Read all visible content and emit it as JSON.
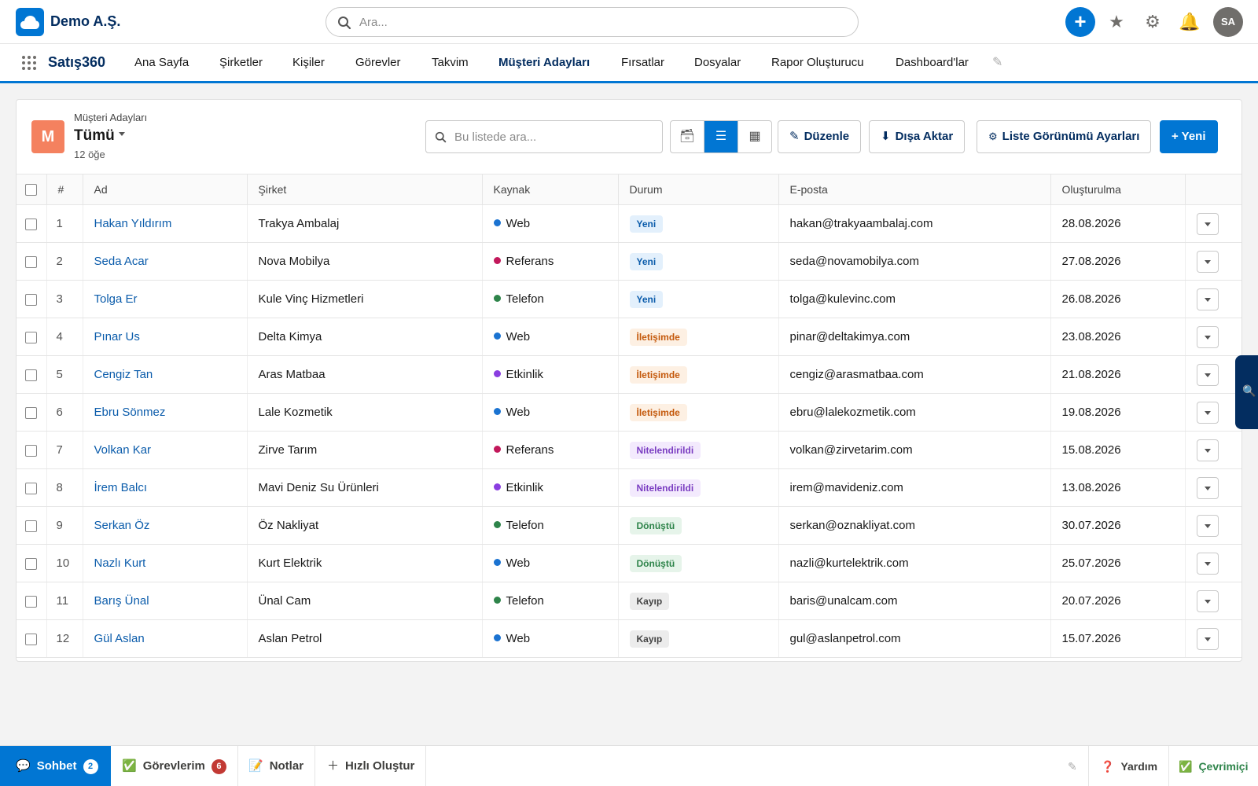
{
  "header": {
    "org_name": "Demo A.Ş.",
    "search_placeholder": "Ara...",
    "avatar_initials": "SA"
  },
  "nav": {
    "app_name": "Satış360",
    "tabs": [
      {
        "label": "Ana Sayfa"
      },
      {
        "label": "Şirketler"
      },
      {
        "label": "Kişiler"
      },
      {
        "label": "Görevler"
      },
      {
        "label": "Takvim"
      },
      {
        "label": "Müşteri Adayları",
        "active": true
      },
      {
        "label": "Fırsatlar"
      },
      {
        "label": "Dosyalar"
      },
      {
        "label": "Rapor Oluşturucu"
      },
      {
        "label": "Dashboard'lar"
      }
    ]
  },
  "list": {
    "object_icon_letter": "M",
    "object_label": "Müşteri Adayları",
    "view_name": "Tümü",
    "item_count": "12 öğe",
    "search_placeholder": "Bu listede ara...",
    "buttons": {
      "edit": "Düzenle",
      "export": "Dışa Aktar",
      "settings": "Liste Görünümü Ayarları",
      "new": "+ Yeni"
    },
    "columns": [
      "#",
      "Ad",
      "Şirket",
      "Kaynak",
      "Durum",
      "E-posta",
      "Oluşturulma"
    ],
    "rows": [
      {
        "num": "1",
        "name": "Hakan Yıldırım",
        "company": "Trakya Ambalaj",
        "source": "Web",
        "status": "Yeni",
        "email": "hakan@trakyaambalaj.com",
        "created": "28.08.2026"
      },
      {
        "num": "2",
        "name": "Seda Acar",
        "company": "Nova Mobilya",
        "source": "Referans",
        "status": "Yeni",
        "email": "seda@novamobilya.com",
        "created": "27.08.2026"
      },
      {
        "num": "3",
        "name": "Tolga Er",
        "company": "Kule Vinç Hizmetleri",
        "source": "Telefon",
        "status": "Yeni",
        "email": "tolga@kulevinc.com",
        "created": "26.08.2026"
      },
      {
        "num": "4",
        "name": "Pınar Us",
        "company": "Delta Kimya",
        "source": "Web",
        "status": "İletişimde",
        "email": "pinar@deltakimya.com",
        "created": "23.08.2026"
      },
      {
        "num": "5",
        "name": "Cengiz Tan",
        "company": "Aras Matbaa",
        "source": "Etkinlik",
        "status": "İletişimde",
        "email": "cengiz@arasmatbaa.com",
        "created": "21.08.2026"
      },
      {
        "num": "6",
        "name": "Ebru Sönmez",
        "company": "Lale Kozmetik",
        "source": "Web",
        "status": "İletişimde",
        "email": "ebru@lalekozmetik.com",
        "created": "19.08.2026"
      },
      {
        "num": "7",
        "name": "Volkan Kar",
        "company": "Zirve Tarım",
        "source": "Referans",
        "status": "Nitelendirildi",
        "email": "volkan@zirvetarim.com",
        "created": "15.08.2026"
      },
      {
        "num": "8",
        "name": "İrem Balcı",
        "company": "Mavi Deniz Su Ürünleri",
        "source": "Etkinlik",
        "status": "Nitelendirildi",
        "email": "irem@mavideniz.com",
        "created": "13.08.2026"
      },
      {
        "num": "9",
        "name": "Serkan Öz",
        "company": "Öz Nakliyat",
        "source": "Telefon",
        "status": "Dönüştü",
        "email": "serkan@oznakliyat.com",
        "created": "30.07.2026"
      },
      {
        "num": "10",
        "name": "Nazlı Kurt",
        "company": "Kurt Elektrik",
        "source": "Web",
        "status": "Dönüştü",
        "email": "nazli@kurtelektrik.com",
        "created": "25.07.2026"
      },
      {
        "num": "11",
        "name": "Barış Ünal",
        "company": "Ünal Cam",
        "source": "Telefon",
        "status": "Kayıp",
        "email": "baris@unalcam.com",
        "created": "20.07.2026"
      },
      {
        "num": "12",
        "name": "Gül Aslan",
        "company": "Aslan Petrol",
        "source": "Web",
        "status": "Kayıp",
        "email": "gul@aslanpetrol.com",
        "created": "15.07.2026"
      }
    ]
  },
  "source_colors": {
    "Web": "#1b73d1",
    "Referans": "#c2185b",
    "Telefon": "#2e844a",
    "Etkinlik": "#8a3ee0"
  },
  "status_styles": {
    "Yeni": {
      "bg": "#e3f0fc",
      "fg": "#0b5cab"
    },
    "İletişimde": {
      "bg": "#fdf0e3",
      "fg": "#c4590c"
    },
    "Nitelendirildi": {
      "bg": "#f3eafd",
      "fg": "#7b3ec2"
    },
    "Dönüştü": {
      "bg": "#e6f4ea",
      "fg": "#2e844a"
    },
    "Kayıp": {
      "bg": "#ececec",
      "fg": "#444444"
    }
  },
  "footer": {
    "chat_label": "Sohbet",
    "chat_count": "2",
    "tasks_label": "Görevlerim",
    "tasks_count": "6",
    "notes_label": "Notlar",
    "quick_create_label": "Hızlı Oluştur",
    "help_label": "Yardım",
    "status_label": "Çevrimiçi"
  }
}
